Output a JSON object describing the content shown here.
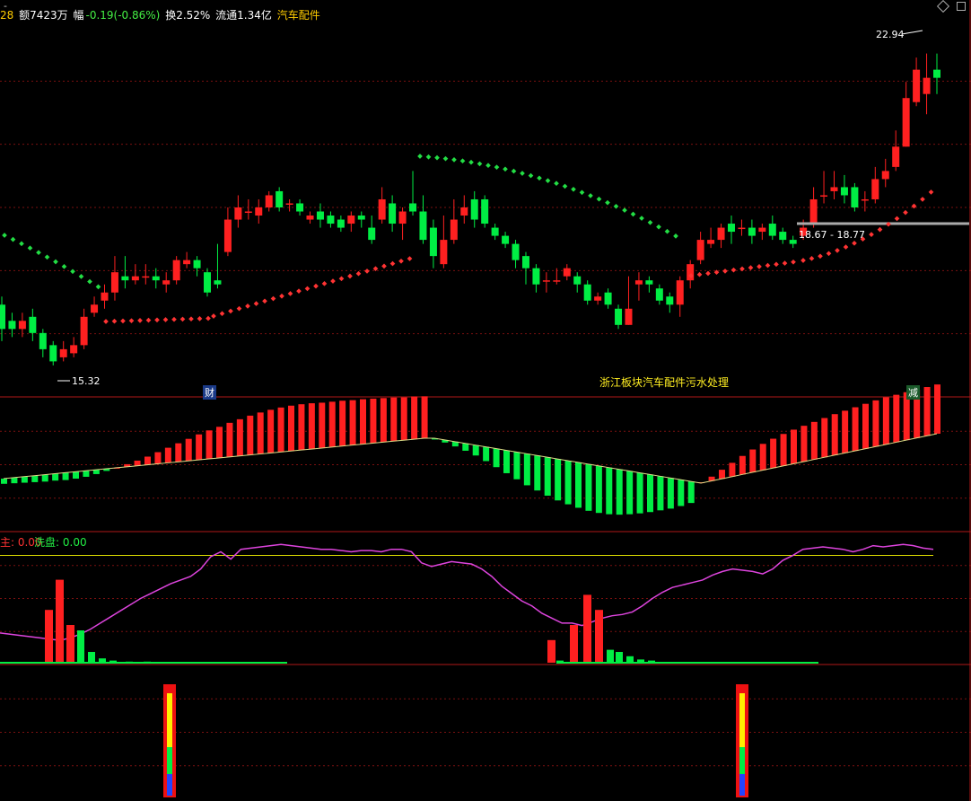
{
  "header": {
    "prefix": "28",
    "amount": "额7423万",
    "change_label": "幅",
    "change_value": "-0.19(-0.86%)",
    "turnover": "换2.52%",
    "float_cap": "流通1.34亿",
    "sector": "汽车配件",
    "dash": "-"
  },
  "annotations": {
    "high_label": "22.94",
    "low_label": "15.32",
    "range_label": "18.67 - 18.77",
    "news_text": "浙江板块汽车配件污水处理",
    "tag_cai": "财",
    "tag_jian": "减"
  },
  "sub3": {
    "label_a": "0.00",
    "label_b_name": "洗盘:",
    "label_b_value": "0.00"
  },
  "colors": {
    "up": "#ff2020",
    "down": "#00ee44",
    "dots_green": "#22dd44",
    "dots_red": "#ff3333",
    "purple": "#dd44dd",
    "yellow": "#dddd00",
    "grid": "#7a1010",
    "divider": "#b01818"
  },
  "chart_data": [
    {
      "type": "candlestick",
      "note_fields": [
        "open",
        "close",
        "high",
        "low"
      ],
      "ylim": [
        14.6,
        23.6
      ],
      "high_marker": 22.94,
      "low_marker": 15.32,
      "support_line": 18.7,
      "candles": [
        [
          16.7,
          16.1,
          16.9,
          15.8
        ],
        [
          16.3,
          16.1,
          16.5,
          15.9
        ],
        [
          16.1,
          16.3,
          16.5,
          15.9
        ],
        [
          16.4,
          16.0,
          16.6,
          15.8
        ],
        [
          16.0,
          15.6,
          16.1,
          15.4
        ],
        [
          15.7,
          15.3,
          15.8,
          15.2
        ],
        [
          15.4,
          15.6,
          15.8,
          15.3
        ],
        [
          15.5,
          15.7,
          15.9,
          15.4
        ],
        [
          15.7,
          16.4,
          16.6,
          15.6
        ],
        [
          16.5,
          16.7,
          16.9,
          16.4
        ],
        [
          16.8,
          17.0,
          17.2,
          16.6
        ],
        [
          17.0,
          17.5,
          17.9,
          16.8
        ],
        [
          17.4,
          17.3,
          17.9,
          17.1
        ],
        [
          17.3,
          17.4,
          17.7,
          17.2
        ],
        [
          17.4,
          17.4,
          17.7,
          17.2
        ],
        [
          17.4,
          17.3,
          17.6,
          17.1
        ],
        [
          17.2,
          17.3,
          17.5,
          17.0
        ],
        [
          17.3,
          17.8,
          17.9,
          17.2
        ],
        [
          17.7,
          17.8,
          18.0,
          17.6
        ],
        [
          17.8,
          17.6,
          17.9,
          17.4
        ],
        [
          17.5,
          17.0,
          17.6,
          16.9
        ],
        [
          17.3,
          17.2,
          18.2,
          17.1
        ],
        [
          18.0,
          18.8,
          19.1,
          17.9
        ],
        [
          18.8,
          19.1,
          19.4,
          18.6
        ],
        [
          19.0,
          19.0,
          19.3,
          18.8
        ],
        [
          18.9,
          19.1,
          19.3,
          18.7
        ],
        [
          19.1,
          19.4,
          19.5,
          19.0
        ],
        [
          19.5,
          19.1,
          19.6,
          19.0
        ],
        [
          19.2,
          19.2,
          19.3,
          19.0
        ],
        [
          19.2,
          19.0,
          19.3,
          18.9
        ],
        [
          18.8,
          18.9,
          19.0,
          18.7
        ],
        [
          19.0,
          18.8,
          19.2,
          18.6
        ],
        [
          18.9,
          18.7,
          19.0,
          18.6
        ],
        [
          18.8,
          18.6,
          18.9,
          18.5
        ],
        [
          18.7,
          18.9,
          19.0,
          18.5
        ],
        [
          18.9,
          18.8,
          19.0,
          18.6
        ],
        [
          18.6,
          18.3,
          18.9,
          18.2
        ],
        [
          18.8,
          19.3,
          19.6,
          18.7
        ],
        [
          19.2,
          18.7,
          19.4,
          18.5
        ],
        [
          18.7,
          19.0,
          19.1,
          18.3
        ],
        [
          19.2,
          19.0,
          20.0,
          18.9
        ],
        [
          19.0,
          18.3,
          19.4,
          18.2
        ],
        [
          18.6,
          17.9,
          18.8,
          17.6
        ],
        [
          17.7,
          18.3,
          18.9,
          17.6
        ],
        [
          18.3,
          18.8,
          19.3,
          18.2
        ],
        [
          18.9,
          19.1,
          19.4,
          18.7
        ],
        [
          19.3,
          18.8,
          19.5,
          18.6
        ],
        [
          19.3,
          18.7,
          19.4,
          18.6
        ],
        [
          18.6,
          18.4,
          18.7,
          18.3
        ],
        [
          18.4,
          18.2,
          18.5,
          18.1
        ],
        [
          18.2,
          17.8,
          18.3,
          17.6
        ],
        [
          17.9,
          17.6,
          18.0,
          17.2
        ],
        [
          17.6,
          17.2,
          17.7,
          17.0
        ],
        [
          17.3,
          17.3,
          17.5,
          17.0
        ],
        [
          17.3,
          17.3,
          17.6,
          17.2
        ],
        [
          17.4,
          17.6,
          17.7,
          17.3
        ],
        [
          17.4,
          17.2,
          17.5,
          17.0
        ],
        [
          17.2,
          16.8,
          17.3,
          16.7
        ],
        [
          16.8,
          16.9,
          17.0,
          16.7
        ],
        [
          17.0,
          16.7,
          17.1,
          16.6
        ],
        [
          16.6,
          16.2,
          16.7,
          16.1
        ],
        [
          16.2,
          16.6,
          17.4,
          16.2
        ],
        [
          17.2,
          17.3,
          17.5,
          16.8
        ],
        [
          17.3,
          17.2,
          17.4,
          17.0
        ],
        [
          17.1,
          16.8,
          17.2,
          16.7
        ],
        [
          16.9,
          16.7,
          17.0,
          16.5
        ],
        [
          16.7,
          17.3,
          17.4,
          16.4
        ],
        [
          17.3,
          17.7,
          17.8,
          17.1
        ],
        [
          17.8,
          18.3,
          18.5,
          17.7
        ],
        [
          18.2,
          18.3,
          18.6,
          18.1
        ],
        [
          18.3,
          18.6,
          18.7,
          18.1
        ],
        [
          18.7,
          18.5,
          18.9,
          18.2
        ],
        [
          18.6,
          18.6,
          18.8,
          18.4
        ],
        [
          18.6,
          18.4,
          18.8,
          18.2
        ],
        [
          18.5,
          18.6,
          18.7,
          18.3
        ],
        [
          18.7,
          18.4,
          18.9,
          18.3
        ],
        [
          18.5,
          18.3,
          18.6,
          18.2
        ],
        [
          18.3,
          18.2,
          18.4,
          18.1
        ],
        [
          18.4,
          18.6,
          18.8,
          18.3
        ],
        [
          18.7,
          19.3,
          19.6,
          18.6
        ],
        [
          19.4,
          19.4,
          20.0,
          19.2
        ],
        [
          19.5,
          19.6,
          20.0,
          19.3
        ],
        [
          19.6,
          19.4,
          19.9,
          19.2
        ],
        [
          19.6,
          19.1,
          19.7,
          19.0
        ],
        [
          19.3,
          19.3,
          19.5,
          19.0
        ],
        [
          19.3,
          19.8,
          20.1,
          19.2
        ],
        [
          19.8,
          20.0,
          20.3,
          19.6
        ],
        [
          20.1,
          20.6,
          21.0,
          20.0
        ],
        [
          20.6,
          21.8,
          22.2,
          20.6
        ],
        [
          21.7,
          22.5,
          22.8,
          21.6
        ],
        [
          21.9,
          22.3,
          22.9,
          21.4
        ],
        [
          22.5,
          22.3,
          22.9,
          21.9
        ]
      ]
    },
    {
      "type": "bar",
      "note": "MACD-style histogram with signal line",
      "values": [
        -1.2,
        -1.3,
        -1.4,
        -1.5,
        -1.6,
        -1.6,
        -1.7,
        -1.6,
        -1.4,
        -1.0,
        -0.5,
        0.0,
        0.6,
        1.2,
        1.9,
        2.7,
        3.5,
        4.3,
        5.1,
        5.9,
        6.6,
        7.2,
        7.9,
        8.5,
        9.1,
        9.6,
        10.0,
        10.3,
        10.5,
        10.6,
        10.6,
        10.5,
        10.5,
        10.5,
        10.4,
        10.4,
        10.3,
        10.2,
        10.1,
        9.9,
        9.9,
        9.7,
        -0.3,
        -0.6,
        -1.1,
        -1.7,
        -2.4,
        -3.3,
        -4.3,
        -5.3,
        -6.3,
        -7.3,
        -8.1,
        -8.9,
        -9.6,
        -10.1,
        -10.5,
        -10.8,
        -10.9,
        -10.8,
        -10.5,
        -10.0,
        -9.4,
        -8.7,
        -7.9,
        -7.1,
        -6.1,
        -5.0,
        0.2,
        1.0,
        2.1,
        3.2,
        4.3,
        5.3,
        6.1,
        6.8,
        7.4,
        7.9,
        8.3,
        8.7,
        9.1,
        9.5,
        9.8,
        10.1,
        10.4,
        10.7,
        10.9,
        11.0,
        11.1,
        11.2,
        11.3,
        11.4
      ],
      "ylim": [
        -13,
        13
      ]
    },
    {
      "type": "line",
      "series": [
        {
          "name": "",
          "values": [
            22,
            21,
            20,
            19,
            18,
            17,
            16,
            18,
            21,
            25,
            30,
            35,
            40,
            45,
            50,
            54,
            58,
            62,
            65,
            68,
            74,
            84,
            88,
            82,
            90,
            91,
            92,
            93,
            94,
            93,
            92,
            91,
            90,
            90,
            89,
            88,
            89,
            89,
            88,
            90,
            90,
            88,
            79,
            76,
            78,
            80,
            79,
            78,
            74,
            68,
            60,
            54,
            48,
            44,
            38,
            34,
            30,
            30,
            28,
            31,
            34,
            36,
            37,
            39,
            44,
            50,
            55,
            59,
            61,
            63,
            65,
            69,
            72,
            74,
            73,
            72,
            70,
            74,
            81,
            85,
            90,
            91,
            92,
            91,
            90,
            88,
            90,
            93,
            92,
            93,
            94,
            93,
            91,
            90
          ]
        }
      ],
      "bars_red": [
        [
          50,
          14
        ],
        [
          62,
          22
        ],
        [
          74,
          10
        ],
        [
          610,
          6
        ],
        [
          635,
          10
        ],
        [
          650,
          18
        ],
        [
          663,
          14
        ]
      ],
      "ylim": [
        0,
        100
      ],
      "ref_line": 85
    }
  ]
}
